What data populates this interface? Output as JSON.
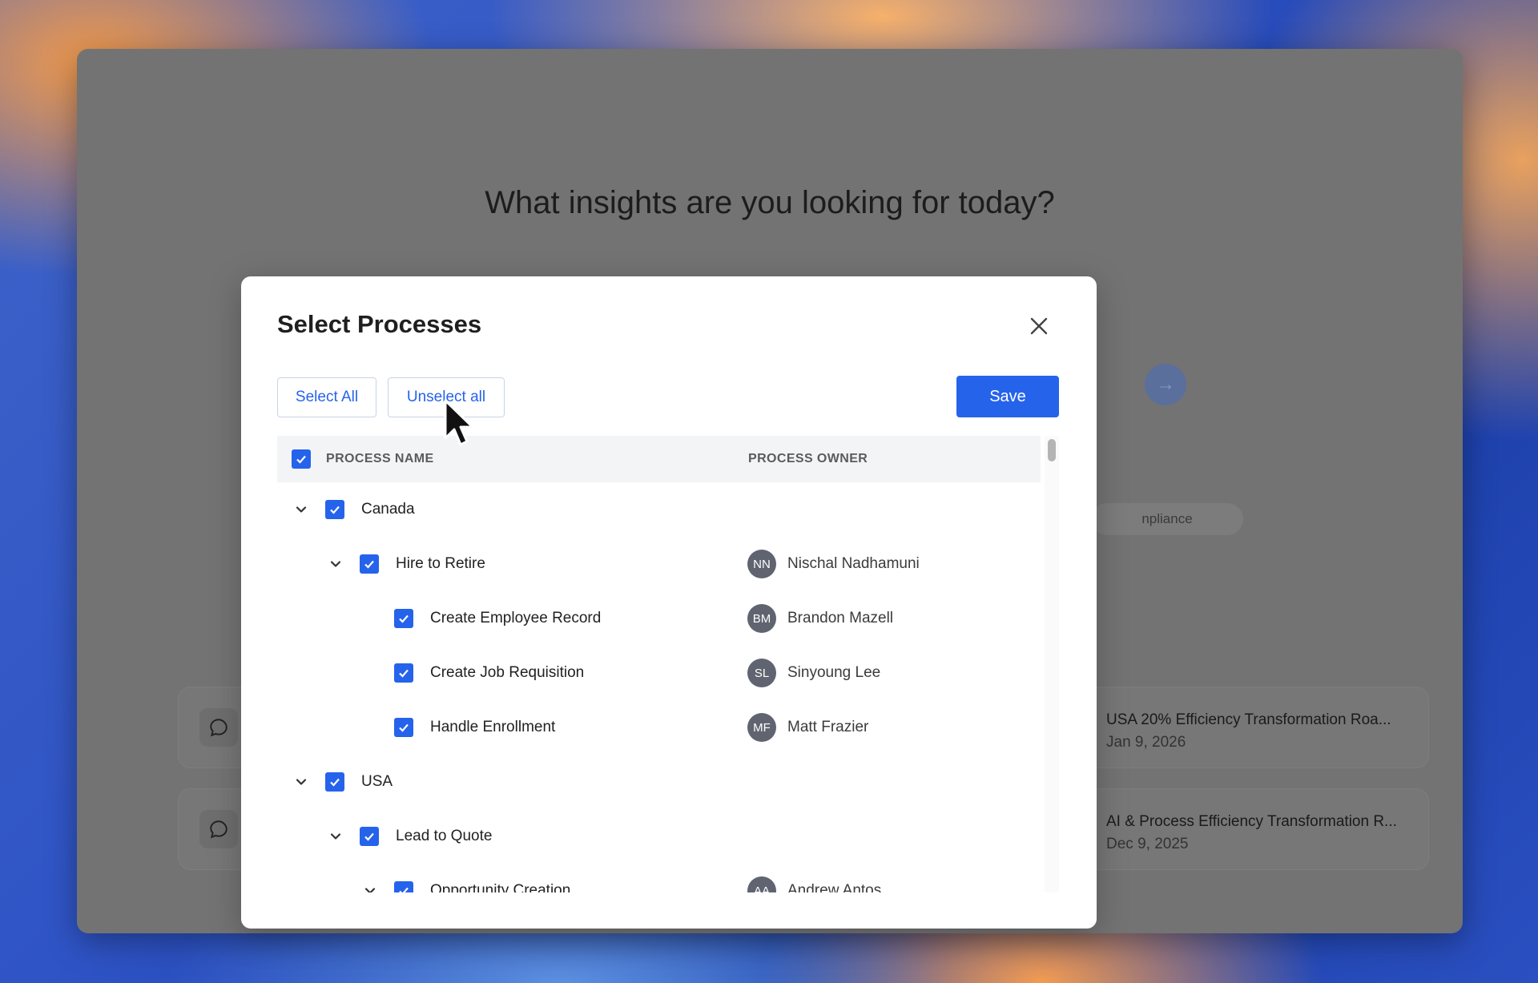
{
  "background": {
    "heading": "What insights are you looking for today?",
    "send_icon": "arrow-right-icon",
    "chip_label": "npliance",
    "cards": [
      {
        "title": "USA 20% Efficiency Transformation Roa...",
        "date": "Jan 9, 2026"
      },
      {
        "title": "AI & Process Efficiency Transformation R...",
        "date": "Dec 9, 2025"
      }
    ]
  },
  "modal": {
    "title": "Select Processes",
    "select_all_label": "Select All",
    "unselect_all_label": "Unselect all",
    "save_label": "Save",
    "columns": {
      "name": "PROCESS NAME",
      "owner": "PROCESS OWNER"
    },
    "rows": [
      {
        "level": 0,
        "name": "Canada",
        "owner": "",
        "initials": "",
        "expandable": true
      },
      {
        "level": 1,
        "name": "Hire to Retire",
        "owner": "Nischal Nadhamuni",
        "initials": "NN",
        "expandable": true
      },
      {
        "level": 2,
        "name": "Create Employee Record",
        "owner": "Brandon Mazell",
        "initials": "BM",
        "expandable": false
      },
      {
        "level": 2,
        "name": "Create Job Requisition",
        "owner": "Sinyoung Lee",
        "initials": "SL",
        "expandable": false
      },
      {
        "level": 2,
        "name": "Handle Enrollment",
        "owner": "Matt Frazier",
        "initials": "MF",
        "expandable": false
      },
      {
        "level": 0,
        "name": "USA",
        "owner": "",
        "initials": "",
        "expandable": true
      },
      {
        "level": 1,
        "name": "Lead to Quote",
        "owner": "",
        "initials": "",
        "expandable": true
      },
      {
        "level": 2,
        "name": "Opportunity Creation",
        "owner": "Andrew Antos",
        "initials": "AA",
        "expandable": true
      }
    ]
  },
  "colors": {
    "accent": "#2563eb",
    "overlay": "#737373"
  }
}
